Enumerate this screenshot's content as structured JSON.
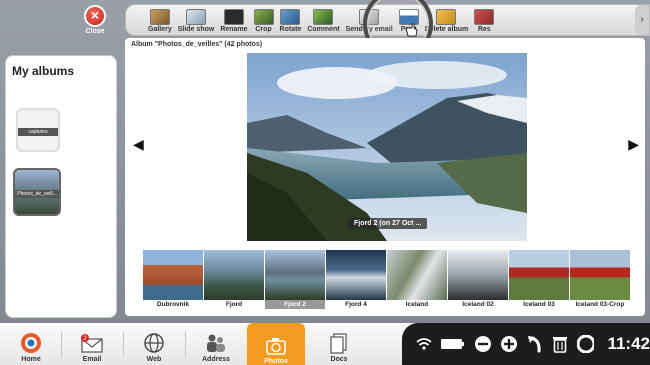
{
  "close_label": "Close",
  "toolbar": {
    "items": [
      {
        "label": "Gallery",
        "icon": "gallery-icon",
        "color": "#8b6b3a"
      },
      {
        "label": "Slide show",
        "icon": "slideshow-icon",
        "color": "#6b7c8a"
      },
      {
        "label": "Rename",
        "icon": "rename-icon",
        "color": "#3a3a3a"
      },
      {
        "label": "Crop",
        "icon": "crop-icon",
        "color": "#5b6b3a"
      },
      {
        "label": "Rotate",
        "icon": "rotate-icon",
        "color": "#4a6a8a"
      },
      {
        "label": "Comment",
        "icon": "comment-icon",
        "color": "#3a5a3a"
      },
      {
        "label": "Send by email",
        "icon": "send-email-icon",
        "color": "#7a7a7a"
      },
      {
        "label": "Print",
        "icon": "print-icon",
        "color": "#2f6fb0"
      },
      {
        "label": "Delete album",
        "icon": "delete-album-icon",
        "color": "#c58b1a"
      },
      {
        "label": "Res",
        "icon": "restore-icon",
        "color": "#8a3a3a"
      }
    ]
  },
  "sidebar": {
    "title": "My albums",
    "albums": [
      {
        "label": "captures"
      },
      {
        "label": "Photos_de_veill..."
      }
    ]
  },
  "main": {
    "album_title": "Album \"Photos_de_veilles\" (42 photos)",
    "photo_caption": "Fjord 2 (on 27 Oct ...",
    "thumbnails": [
      {
        "label": "Dubrovnik"
      },
      {
        "label": "Fjord"
      },
      {
        "label": "Fjord 2",
        "selected": true
      },
      {
        "label": "Fjord 4"
      },
      {
        "label": "Iceland"
      },
      {
        "label": "Iceland 02"
      },
      {
        "label": "Iceland 03"
      },
      {
        "label": "Iceland 03-Crop"
      }
    ]
  },
  "bottom_nav": {
    "items": [
      {
        "label": "Home",
        "icon": "home-icon"
      },
      {
        "label": "Email",
        "icon": "email-icon",
        "badge": "2"
      },
      {
        "label": "Web",
        "icon": "web-icon"
      },
      {
        "label": "Address",
        "icon": "address-icon"
      },
      {
        "label": "Photos",
        "icon": "camera-icon",
        "active": true
      },
      {
        "label": "Docs",
        "icon": "docs-icon"
      }
    ]
  },
  "status": {
    "clock": "11:42"
  },
  "colors": {
    "accent_orange": "#f39a1f",
    "close_red": "#d42a1f",
    "status_bar": "#1d1d1d"
  }
}
